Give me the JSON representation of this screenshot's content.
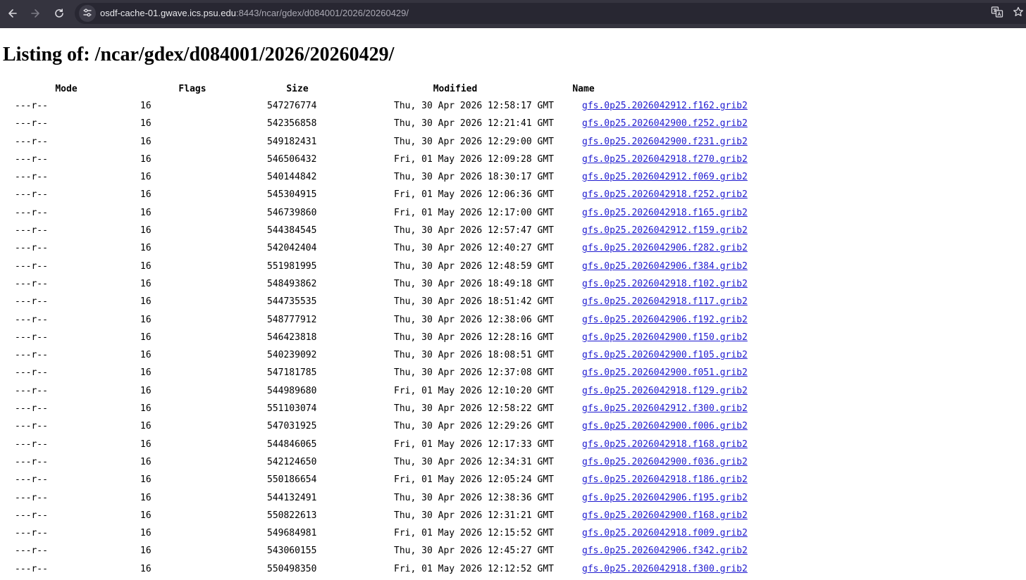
{
  "browser": {
    "url_host": "osdf-cache-01.gwave.ics.psu.edu",
    "url_path": ":8443/ncar/gdex/d084001/2026/20260429/",
    "toolbar_color": "#35343f",
    "icons": [
      "back-arrow-icon",
      "forward-arrow-icon",
      "reload-icon",
      "site-info-icon",
      "translate-icon",
      "bookmark-star-icon"
    ]
  },
  "page": {
    "title": "Listing of: /ncar/gdex/d084001/2026/20260429/"
  },
  "table": {
    "headers": {
      "mode": "Mode",
      "flags": "Flags",
      "size": "Size",
      "modified": "Modified",
      "name": "Name"
    },
    "link_color": "#1f1bd0",
    "rows": [
      {
        "mode": "---r--",
        "flags": "16",
        "size": "547276774",
        "modified": "Thu, 30 Apr 2026 12:58:17 GMT",
        "name": "gfs.0p25.2026042912.f162.grib2"
      },
      {
        "mode": "---r--",
        "flags": "16",
        "size": "542356858",
        "modified": "Thu, 30 Apr 2026 12:21:41 GMT",
        "name": "gfs.0p25.2026042900.f252.grib2"
      },
      {
        "mode": "---r--",
        "flags": "16",
        "size": "549182431",
        "modified": "Thu, 30 Apr 2026 12:29:00 GMT",
        "name": "gfs.0p25.2026042900.f231.grib2"
      },
      {
        "mode": "---r--",
        "flags": "16",
        "size": "546506432",
        "modified": "Fri, 01 May 2026 12:09:28 GMT",
        "name": "gfs.0p25.2026042918.f270.grib2"
      },
      {
        "mode": "---r--",
        "flags": "16",
        "size": "540144842",
        "modified": "Thu, 30 Apr 2026 18:30:17 GMT",
        "name": "gfs.0p25.2026042912.f069.grib2"
      },
      {
        "mode": "---r--",
        "flags": "16",
        "size": "545304915",
        "modified": "Fri, 01 May 2026 12:06:36 GMT",
        "name": "gfs.0p25.2026042918.f252.grib2"
      },
      {
        "mode": "---r--",
        "flags": "16",
        "size": "546739860",
        "modified": "Fri, 01 May 2026 12:17:00 GMT",
        "name": "gfs.0p25.2026042918.f165.grib2"
      },
      {
        "mode": "---r--",
        "flags": "16",
        "size": "544384545",
        "modified": "Thu, 30 Apr 2026 12:57:47 GMT",
        "name": "gfs.0p25.2026042912.f159.grib2"
      },
      {
        "mode": "---r--",
        "flags": "16",
        "size": "542042404",
        "modified": "Thu, 30 Apr 2026 12:40:27 GMT",
        "name": "gfs.0p25.2026042906.f282.grib2"
      },
      {
        "mode": "---r--",
        "flags": "16",
        "size": "551981995",
        "modified": "Thu, 30 Apr 2026 12:48:59 GMT",
        "name": "gfs.0p25.2026042906.f384.grib2"
      },
      {
        "mode": "---r--",
        "flags": "16",
        "size": "548493862",
        "modified": "Thu, 30 Apr 2026 18:49:18 GMT",
        "name": "gfs.0p25.2026042918.f102.grib2"
      },
      {
        "mode": "---r--",
        "flags": "16",
        "size": "544735535",
        "modified": "Thu, 30 Apr 2026 18:51:42 GMT",
        "name": "gfs.0p25.2026042918.f117.grib2"
      },
      {
        "mode": "---r--",
        "flags": "16",
        "size": "548777912",
        "modified": "Thu, 30 Apr 2026 12:38:06 GMT",
        "name": "gfs.0p25.2026042906.f192.grib2"
      },
      {
        "mode": "---r--",
        "flags": "16",
        "size": "546423818",
        "modified": "Thu, 30 Apr 2026 12:28:16 GMT",
        "name": "gfs.0p25.2026042900.f150.grib2"
      },
      {
        "mode": "---r--",
        "flags": "16",
        "size": "540239092",
        "modified": "Thu, 30 Apr 2026 18:08:51 GMT",
        "name": "gfs.0p25.2026042900.f105.grib2"
      },
      {
        "mode": "---r--",
        "flags": "16",
        "size": "547181785",
        "modified": "Thu, 30 Apr 2026 12:37:08 GMT",
        "name": "gfs.0p25.2026042900.f051.grib2"
      },
      {
        "mode": "---r--",
        "flags": "16",
        "size": "544989680",
        "modified": "Fri, 01 May 2026 12:10:20 GMT",
        "name": "gfs.0p25.2026042918.f129.grib2"
      },
      {
        "mode": "---r--",
        "flags": "16",
        "size": "551103074",
        "modified": "Thu, 30 Apr 2026 12:58:22 GMT",
        "name": "gfs.0p25.2026042912.f300.grib2"
      },
      {
        "mode": "---r--",
        "flags": "16",
        "size": "547031925",
        "modified": "Thu, 30 Apr 2026 12:29:26 GMT",
        "name": "gfs.0p25.2026042900.f006.grib2"
      },
      {
        "mode": "---r--",
        "flags": "16",
        "size": "544846065",
        "modified": "Fri, 01 May 2026 12:17:33 GMT",
        "name": "gfs.0p25.2026042918.f168.grib2"
      },
      {
        "mode": "---r--",
        "flags": "16",
        "size": "542124650",
        "modified": "Thu, 30 Apr 2026 12:34:31 GMT",
        "name": "gfs.0p25.2026042900.f036.grib2"
      },
      {
        "mode": "---r--",
        "flags": "16",
        "size": "550186654",
        "modified": "Fri, 01 May 2026 12:05:24 GMT",
        "name": "gfs.0p25.2026042918.f186.grib2"
      },
      {
        "mode": "---r--",
        "flags": "16",
        "size": "544132491",
        "modified": "Thu, 30 Apr 2026 12:38:36 GMT",
        "name": "gfs.0p25.2026042906.f195.grib2"
      },
      {
        "mode": "---r--",
        "flags": "16",
        "size": "550822613",
        "modified": "Thu, 30 Apr 2026 12:31:21 GMT",
        "name": "gfs.0p25.2026042900.f168.grib2"
      },
      {
        "mode": "---r--",
        "flags": "16",
        "size": "549684981",
        "modified": "Fri, 01 May 2026 12:15:52 GMT",
        "name": "gfs.0p25.2026042918.f009.grib2"
      },
      {
        "mode": "---r--",
        "flags": "16",
        "size": "543060155",
        "modified": "Thu, 30 Apr 2026 12:45:27 GMT",
        "name": "gfs.0p25.2026042906.f342.grib2"
      },
      {
        "mode": "---r--",
        "flags": "16",
        "size": "550498350",
        "modified": "Fri, 01 May 2026 12:12:52 GMT",
        "name": "gfs.0p25.2026042918.f300.grib2"
      }
    ]
  }
}
